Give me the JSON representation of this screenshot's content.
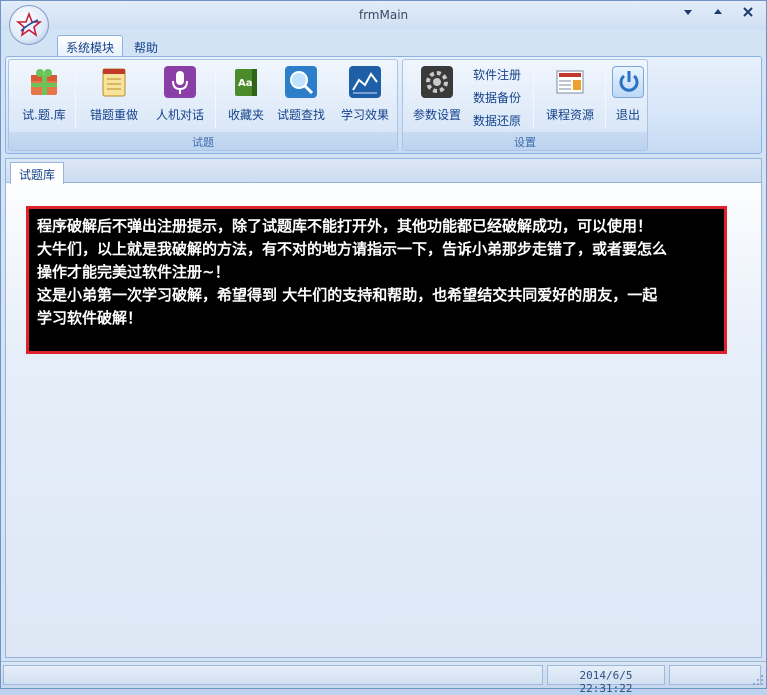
{
  "window": {
    "title": "frmMain",
    "controls": [
      "minimize-icon",
      "maximize-icon",
      "close-icon"
    ]
  },
  "ribbon": {
    "tabs": [
      {
        "label": "系统模块",
        "active": true
      },
      {
        "label": "帮助",
        "active": false
      }
    ],
    "groups": [
      {
        "caption": "试题",
        "buttons": [
          {
            "label": "试.题.库",
            "icon": "gift-box-icon"
          },
          {
            "label": "错题重做",
            "icon": "notepad-icon"
          },
          {
            "label": "人机对话",
            "icon": "microphone-icon"
          },
          {
            "label": "收藏夹",
            "icon": "book-icon"
          },
          {
            "label": "试题查找",
            "icon": "magnifier-icon"
          },
          {
            "label": "学习效果",
            "icon": "chart-icon"
          }
        ]
      },
      {
        "caption": "设置",
        "buttons": [
          {
            "label": "参数设置",
            "icon": "gear-icon"
          },
          {
            "label": "课程资源",
            "icon": "newspaper-icon"
          },
          {
            "label": "退出",
            "icon": "power-icon"
          }
        ],
        "small_buttons": [
          "软件注册",
          "数据备份",
          "数据还原"
        ]
      }
    ]
  },
  "document": {
    "tab_label": "试题库",
    "message_lines": [
      " 程序破解后不弹出注册提示，除了试题库不能打开外，其他功能都已经破解成功，可以使用！",
      "大牛们，以上就是我破解的方法，有不对的地方请指示一下，告诉小弟那步走错了，或者要怎么",
      "操作才能完美过软件注册~！",
      "这是小弟第一次学习破解，希望得到 大牛们的支持和帮助，也希望结交共同爱好的朋友，一起",
      "学习软件破解！"
    ]
  },
  "statusbar": {
    "datetime": "2014/6/5 22:31:22"
  },
  "colors": {
    "message_background": "#000000",
    "message_border": "#e0232a",
    "message_text": "#ffffff",
    "ribbon_text": "#15428b"
  }
}
